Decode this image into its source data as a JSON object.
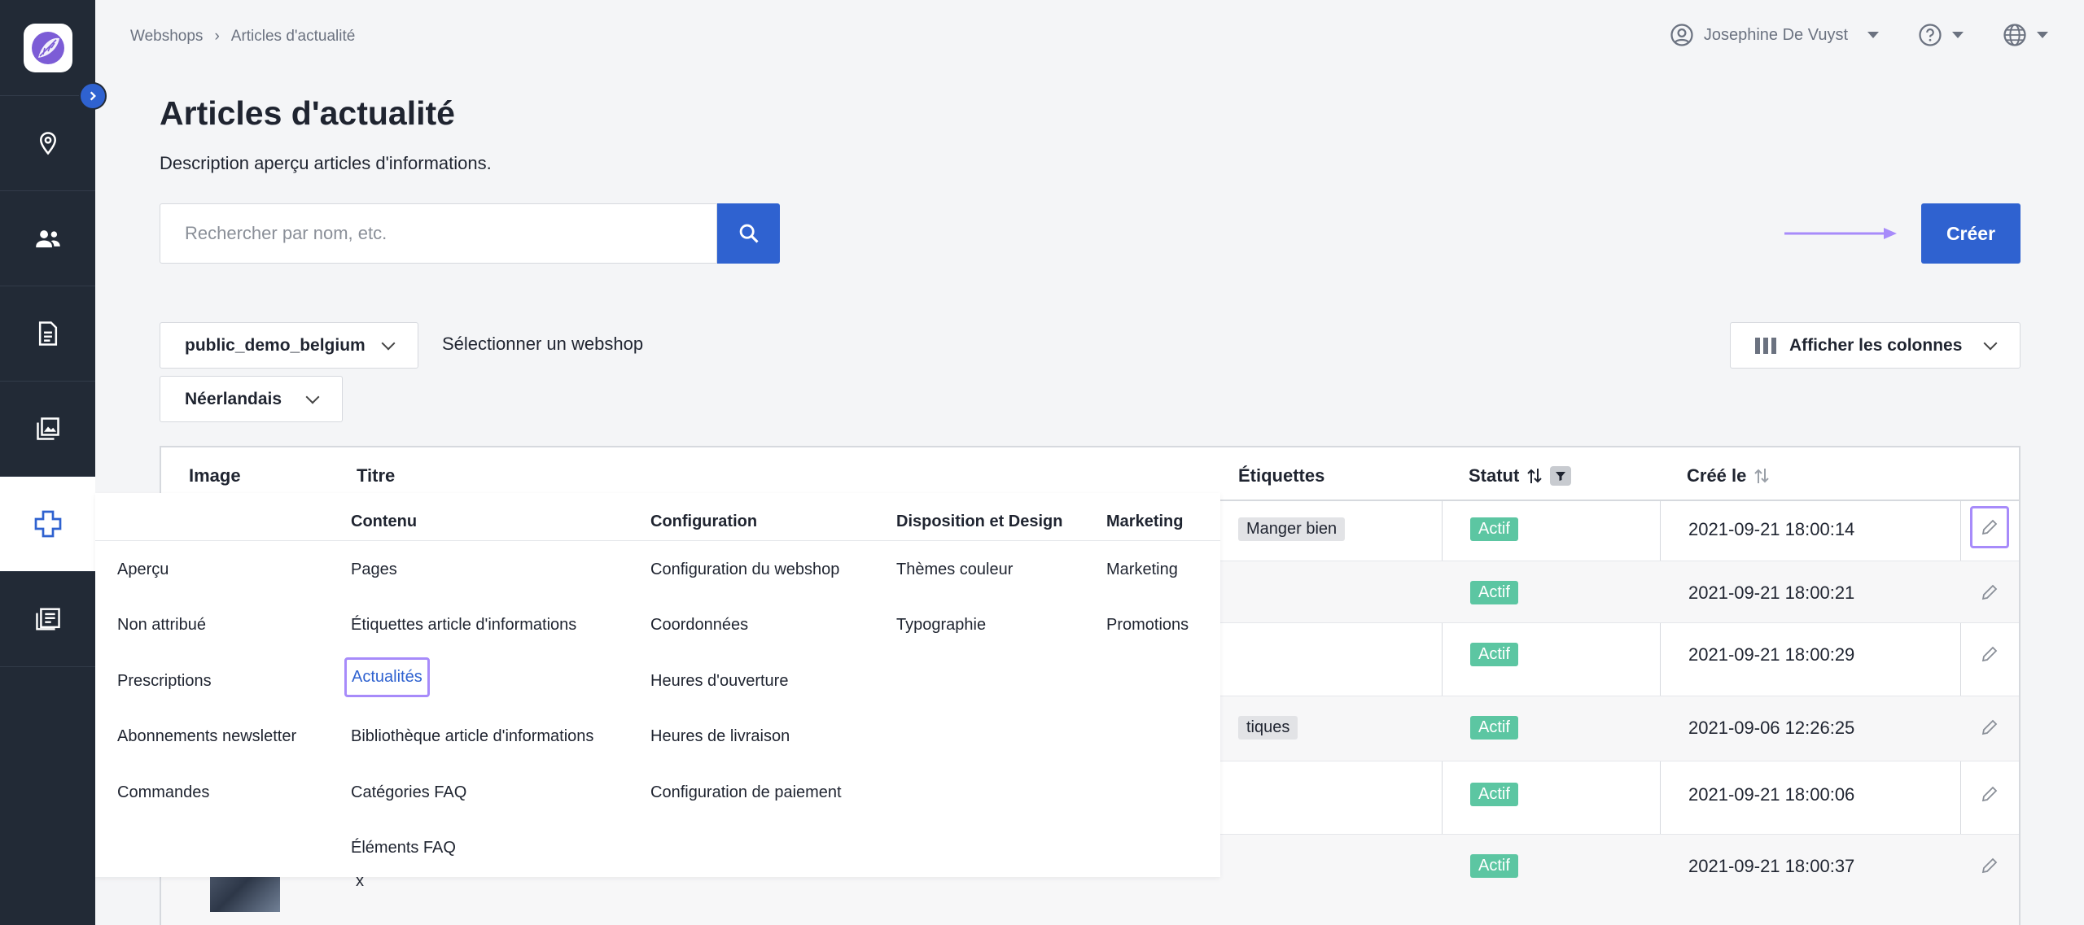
{
  "breadcrumb": [
    "Webshops",
    "Articles d'actualité"
  ],
  "user": {
    "name": "Josephine De Vuyst"
  },
  "page": {
    "title": "Articles d'actualité",
    "description": "Description aperçu articles d'informations."
  },
  "search": {
    "placeholder": "Rechercher par nom, etc."
  },
  "create_label": "Créer",
  "webshop_select": {
    "value": "public_demo_belgium",
    "label": "Sélectionner un webshop"
  },
  "language_select": {
    "value": "Néerlandais"
  },
  "columns_button": "Afficher les colonnes",
  "table": {
    "headers": {
      "image": "Image",
      "title": "Titre",
      "tags": "Étiquettes",
      "status": "Statut",
      "created": "Créé le"
    },
    "rows": [
      {
        "tag": "Manger bien",
        "status": "Actif",
        "created": "2021-09-21 18:00:14"
      },
      {
        "tag": "",
        "status": "Actif",
        "created": "2021-09-21 18:00:21"
      },
      {
        "tag": "",
        "status": "Actif",
        "created": "2021-09-21 18:00:29"
      },
      {
        "tag": "tiques",
        "status": "Actif",
        "created": "2021-09-06 12:26:25"
      },
      {
        "tag": "",
        "status": "Actif",
        "created": "2021-09-21 18:00:06"
      },
      {
        "tag": "",
        "status": "Actif",
        "created": "2021-09-21 18:00:37"
      }
    ],
    "last_row_title_fragment": "x"
  },
  "mega_menu": {
    "col0": {
      "heading": "",
      "items": [
        "Aperçu",
        "Non attribué",
        "Prescriptions",
        "Abonnements newsletter",
        "Commandes"
      ]
    },
    "col1": {
      "heading": "Contenu",
      "items": [
        "Pages",
        "Étiquettes article d'informations",
        "Actualités",
        "Bibliothèque article d'informations",
        "Catégories FAQ",
        "Éléments FAQ"
      ]
    },
    "col2": {
      "heading": "Configuration",
      "items": [
        "Configuration du webshop",
        "Coordonnées",
        "Heures d'ouverture",
        "Heures de livraison",
        "Configuration de paiement"
      ]
    },
    "col3": {
      "heading": "Disposition et Design",
      "items": [
        "Thèmes couleur",
        "Typographie"
      ]
    },
    "col4": {
      "heading": "Marketing",
      "items": [
        "Marketing",
        "Promotions"
      ]
    }
  },
  "colors": {
    "primary": "#2f62d0",
    "sidebar": "#222a36",
    "status_green": "#5cc6a2",
    "highlight": "#a78bfa"
  }
}
